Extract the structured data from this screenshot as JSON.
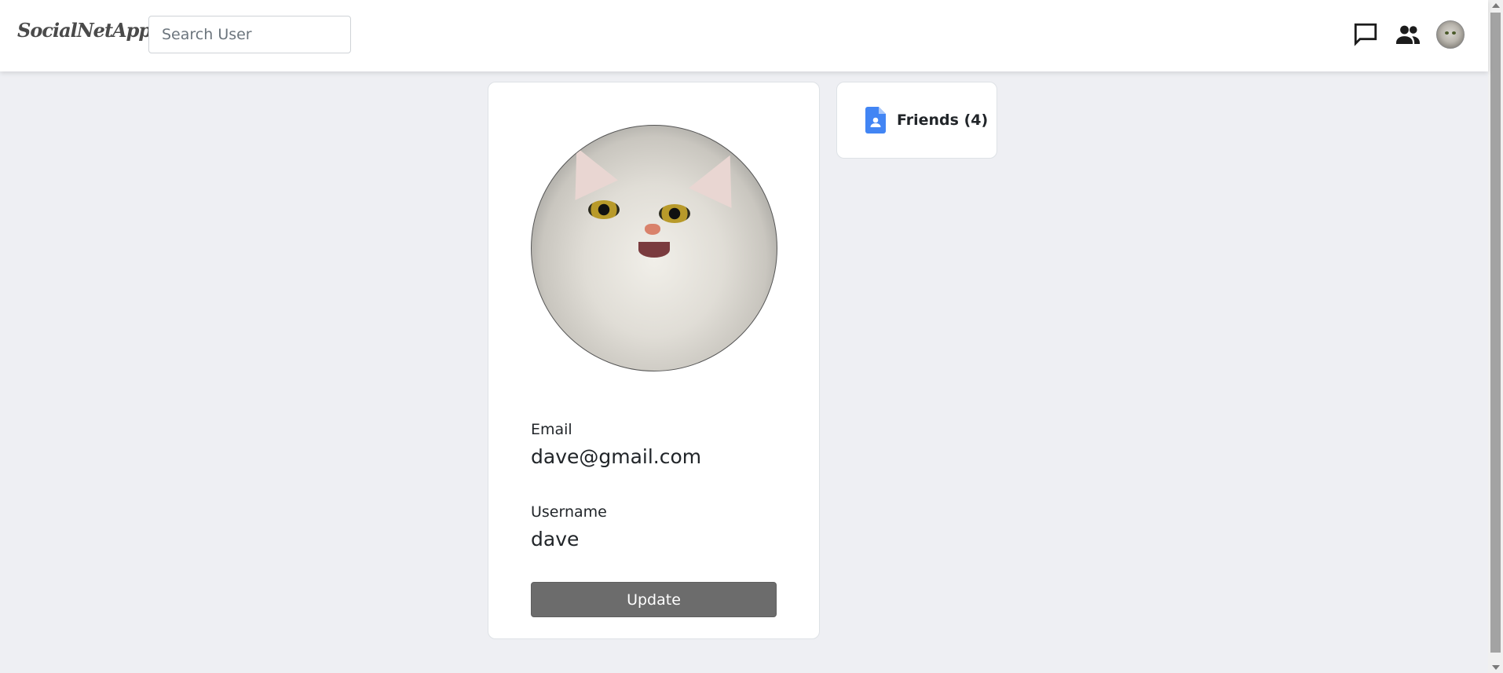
{
  "app": {
    "brand": "SocialNetApp"
  },
  "search": {
    "placeholder": "Search User",
    "value": ""
  },
  "nav": {
    "icons": [
      "chat-icon",
      "people-icon",
      "avatar"
    ]
  },
  "profile": {
    "email_label": "Email",
    "email": "dave@gmail.com",
    "username_label": "Username",
    "username": "dave",
    "update_label": "Update"
  },
  "friends": {
    "label": "Friends (4)",
    "icon": "contact-document-icon",
    "icon_color": "#4285f4"
  },
  "colors": {
    "page_bg": "#eeeff3",
    "update_button": "#6c6c6c"
  }
}
